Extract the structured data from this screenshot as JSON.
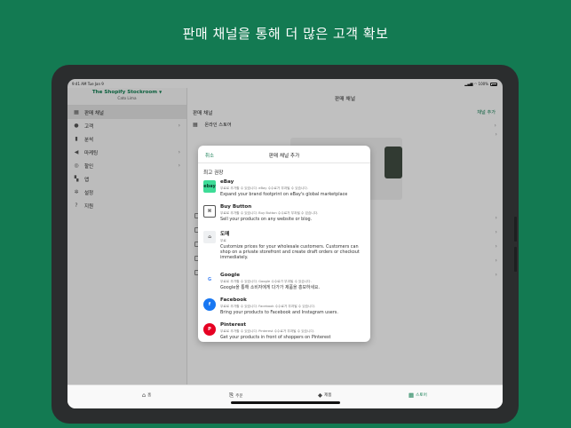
{
  "headline": "판매 채널을 통해 더 많은 고객 확보",
  "status": {
    "time": "9:41 AM   Tue Jan 9",
    "indicators": "▂▄▆ ◠ 100%"
  },
  "sidebar": {
    "store_name": "The Shopify Stockroom",
    "store_location": "Cato Lima",
    "items": [
      {
        "label": "판매 채널",
        "icon": "storefront-icon",
        "glyph": "▦",
        "chevron": false
      },
      {
        "label": "고객",
        "icon": "person-icon",
        "glyph": "●",
        "chevron": true
      },
      {
        "label": "분석",
        "icon": "bar-chart-icon",
        "glyph": "▮",
        "chevron": false
      },
      {
        "label": "마케팅",
        "icon": "megaphone-icon",
        "glyph": "◀",
        "chevron": true
      },
      {
        "label": "할인",
        "icon": "discount-icon",
        "glyph": "◎",
        "chevron": true
      },
      {
        "label": "앱",
        "icon": "apps-icon",
        "glyph": "▚",
        "chevron": false
      },
      {
        "label": "설정",
        "icon": "gear-icon",
        "glyph": "✲",
        "chevron": false
      },
      {
        "label": "지원",
        "icon": "help-icon",
        "glyph": "?",
        "chevron": false
      }
    ]
  },
  "main": {
    "title": "판매 채널",
    "section_title": "판매 채널",
    "add_channel_label": "채널 추가",
    "online_store_label": "온라인 스토어"
  },
  "modal": {
    "cancel_label": "취소",
    "title": "판매 채널 추가",
    "recommended_title": "최고 권장",
    "channels": [
      {
        "name": "eBay",
        "meta": "무료로 추가할 수 있습니다. eBay 수수료가 부과될 수 있습니다.",
        "desc": "Expand your brand footprint on eBay's global marketplace",
        "logo_text": "ebay",
        "icon": "ebay-logo-icon"
      },
      {
        "name": "Buy Button",
        "meta": "무료로 추가할 수 있습니다. Buy Button 수수료가 부과될 수 있습니다.",
        "desc": "Sell your products on any website or blog.",
        "logo_text": "⌘",
        "icon": "buy-button-logo-icon"
      },
      {
        "name": "도매",
        "meta": "무료",
        "desc": "Customize prices for your wholesale customers. Customers can shop on a private storefront and create draft orders or checkout immediately.",
        "logo_text": "⌂",
        "icon": "wholesale-logo-icon"
      },
      {
        "name": "Google",
        "meta": "무료로 추가할 수 있습니다. Google 수수료가 부과될 수 있습니다.",
        "desc": "Google을 통해 소비자에게 다가가 제품을 홍보하세요.",
        "logo_text": "G",
        "icon": "google-logo-icon"
      },
      {
        "name": "Facebook",
        "meta": "무료로 추가할 수 있습니다. Facebook 수수료가 부과될 수 있습니다.",
        "desc": "Bring your products to Facebook and Instagram users.",
        "logo_text": "f",
        "icon": "facebook-logo-icon"
      },
      {
        "name": "Pinterest",
        "meta": "무료로 추가할 수 있습니다. Pinterest 수수료가 부과될 수 있습니다.",
        "desc": "Get your products in front of shoppers on Pinterest",
        "logo_text": "P",
        "icon": "pinterest-logo-icon"
      }
    ]
  },
  "tabbar": {
    "tabs": [
      {
        "label": "홈",
        "icon": "home-icon",
        "glyph": "⌂"
      },
      {
        "label": "주문",
        "icon": "orders-icon",
        "glyph": "⎘"
      },
      {
        "label": "제품",
        "icon": "tag-icon",
        "glyph": "◆"
      },
      {
        "label": "스토어",
        "icon": "store-icon",
        "glyph": "▦"
      }
    ],
    "active_tab": "스토어"
  },
  "colors": {
    "brand_green": "#0e7a4e",
    "background": "#137a52",
    "ebay": "#3ddc97",
    "google_blue": "#4285f4",
    "facebook": "#1877f2",
    "pinterest": "#e60023"
  }
}
